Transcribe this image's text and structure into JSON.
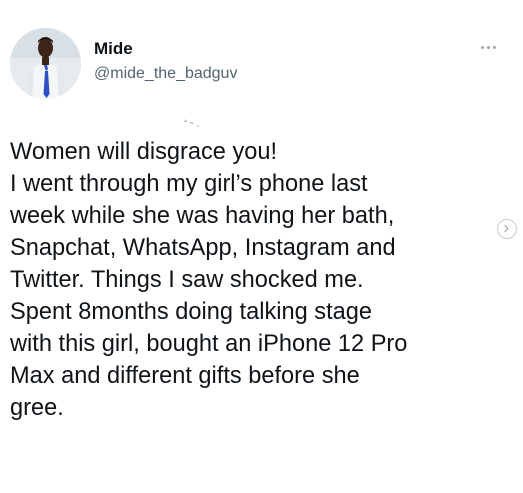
{
  "tweet": {
    "author": {
      "display_name": "Mide",
      "handle": "@mide_the_badguv",
      "avatar_icon": "profile-photo"
    },
    "more_icon": "more-options-icon",
    "text_lines": [
      "Women will disgrace you!",
      "I went through my girl’s phone last",
      "week while she was having her bath,",
      "Snapchat, WhatsApp, Instagram and",
      "Twitter.  Things I saw shocked me.",
      "Spent 8months doing talking stage",
      "with this girl, bought an iPhone 12 Pro",
      "Max and different gifts before she",
      "gree."
    ],
    "next_icon": "chevron-right-icon"
  },
  "colors": {
    "text": "#0f1419",
    "secondary": "#536471",
    "icon_gray": "#9aa6b0"
  }
}
